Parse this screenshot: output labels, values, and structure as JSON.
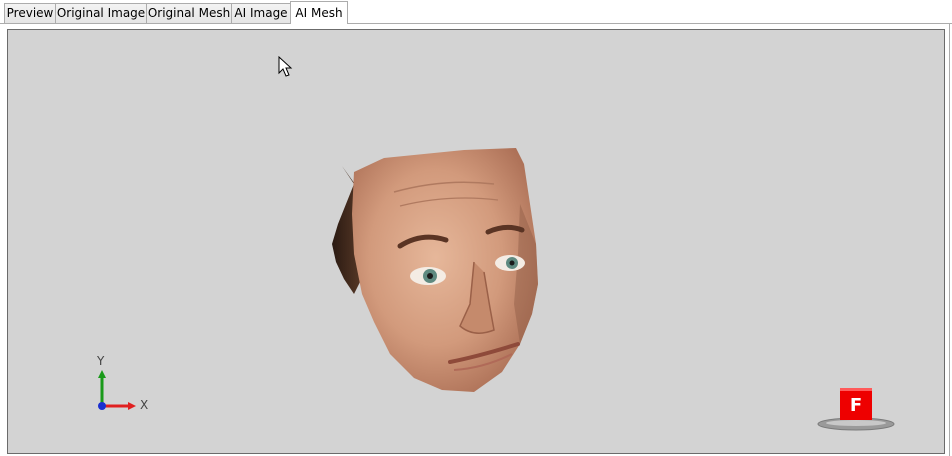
{
  "tabs": [
    {
      "label": "Preview",
      "active": false
    },
    {
      "label": "Original Image",
      "active": false
    },
    {
      "label": "Original Mesh",
      "active": false
    },
    {
      "label": "AI Image",
      "active": false
    },
    {
      "label": "AI Mesh",
      "active": true
    }
  ],
  "viewport": {
    "background_color": "#d3d3d3",
    "content": "textured-3d-face-mesh"
  },
  "axis_gizmo": {
    "y_label": "Y",
    "x_label": "X",
    "y_color": "#1a9a1a",
    "x_color": "#e02020",
    "origin_color": "#1a2fd0"
  },
  "view_cube": {
    "face_label": "F",
    "face_color": "#ee0000"
  },
  "icons": {
    "cursor": "arrow-cursor-icon"
  }
}
